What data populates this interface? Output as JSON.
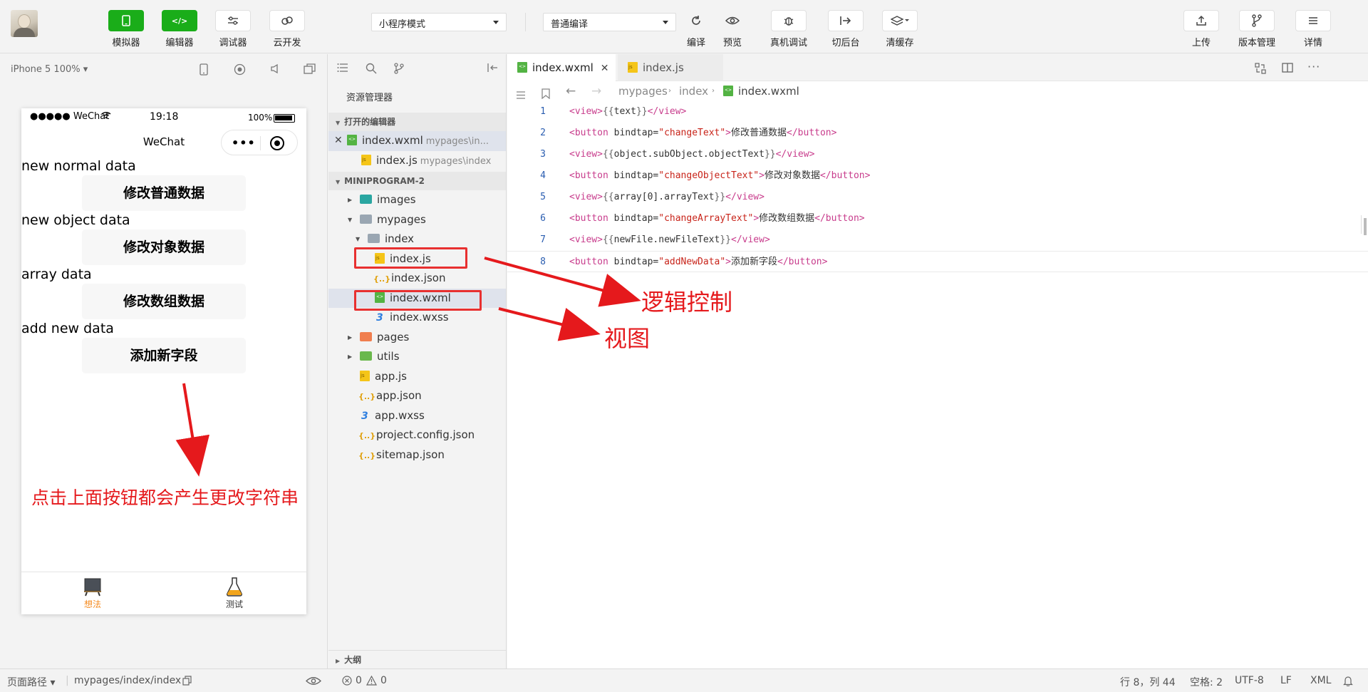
{
  "toolbar": {
    "simulator": "模拟器",
    "editor": "编辑器",
    "debugger": "调试器",
    "cloud": "云开发",
    "mode_select": "小程序模式",
    "compile_select": "普通编译",
    "compile": "编译",
    "preview": "预览",
    "real_debug": "真机调试",
    "background": "切后台",
    "clear_cache": "清缓存",
    "upload": "上传",
    "version": "版本管理",
    "details": "详情"
  },
  "simulator": {
    "device": "iPhone 5 100% ▾",
    "status": {
      "signal": "●●●●● WeChat",
      "time": "19:18",
      "battery": "100%"
    },
    "nav_title": "WeChat",
    "capsule_dots": "•••",
    "rows": [
      {
        "text": "new normal data",
        "button": "修改普通数据"
      },
      {
        "text": "new object data",
        "button": "修改对象数据"
      },
      {
        "text": "array data",
        "button": "修改数组数据"
      },
      {
        "text": "add new data",
        "button": "添加新字段"
      }
    ],
    "tabs": [
      {
        "label": "想法"
      },
      {
        "label": "测试"
      }
    ],
    "colors": {
      "tab_active": "#f58a1f",
      "tab_inactive": "#333333"
    }
  },
  "explorer": {
    "title": "资源管理器",
    "open_editors": "打开的编辑器",
    "open_files": [
      {
        "name": "index.wxml",
        "path": "mypages\\in..."
      },
      {
        "name": "index.js",
        "path": "mypages\\index"
      }
    ],
    "project": "MINIPROGRAM-2",
    "tree": {
      "images": "images",
      "mypages": "mypages",
      "index": "index",
      "index_js": "index.js",
      "index_json": "index.json",
      "index_wxml": "index.wxml",
      "index_wxss": "index.wxss",
      "pages": "pages",
      "utils": "utils",
      "app_js": "app.js",
      "app_json": "app.json",
      "app_wxss": "app.wxss",
      "project_config": "project.config.json",
      "sitemap": "sitemap.json"
    },
    "outline": "大纲"
  },
  "editor": {
    "tabs": [
      {
        "label": "index.wxml"
      },
      {
        "label": "index.js"
      }
    ],
    "breadcrumb": {
      "a": "mypages",
      "b": "index",
      "c": "index.wxml"
    },
    "lines": [
      {
        "n": "1",
        "parts": [
          [
            "t-tag",
            "<view>"
          ],
          [
            "t-mus",
            "{{"
          ],
          [
            "t-txt",
            "text"
          ],
          [
            "t-mus",
            "}}"
          ],
          [
            "t-tag",
            "</view>"
          ]
        ]
      },
      {
        "n": "2",
        "parts": [
          [
            "t-tag",
            "<button "
          ],
          [
            "t-attr",
            "bindtap="
          ],
          [
            "t-str",
            "\"changeText\""
          ],
          [
            "t-tag",
            ">"
          ],
          [
            "t-txt",
            "修改普通数据"
          ],
          [
            "t-tag",
            "</button>"
          ]
        ]
      },
      {
        "n": "3",
        "parts": [
          [
            "t-tag",
            "<view>"
          ],
          [
            "t-mus",
            "{{"
          ],
          [
            "t-txt",
            "object.subObject.objectText"
          ],
          [
            "t-mus",
            "}}"
          ],
          [
            "t-tag",
            "</view>"
          ]
        ]
      },
      {
        "n": "4",
        "parts": [
          [
            "t-tag",
            "<button "
          ],
          [
            "t-attr",
            "bindtap="
          ],
          [
            "t-str",
            "\"changeObjectText\""
          ],
          [
            "t-tag",
            ">"
          ],
          [
            "t-txt",
            "修改对象数据"
          ],
          [
            "t-tag",
            "</button>"
          ]
        ]
      },
      {
        "n": "5",
        "parts": [
          [
            "t-tag",
            "<view>"
          ],
          [
            "t-mus",
            "{{"
          ],
          [
            "t-txt",
            "array[0].arrayText"
          ],
          [
            "t-mus",
            "}}"
          ],
          [
            "t-tag",
            "</view>"
          ]
        ]
      },
      {
        "n": "6",
        "parts": [
          [
            "t-tag",
            "<button "
          ],
          [
            "t-attr",
            "bindtap="
          ],
          [
            "t-str",
            "\"changeArrayText\""
          ],
          [
            "t-tag",
            ">"
          ],
          [
            "t-txt",
            "修改数组数据"
          ],
          [
            "t-tag",
            "</button>"
          ]
        ]
      },
      {
        "n": "7",
        "parts": [
          [
            "t-tag",
            "<view>"
          ],
          [
            "t-mus",
            "{{"
          ],
          [
            "t-txt",
            "newFile.newFileText"
          ],
          [
            "t-mus",
            "}}"
          ],
          [
            "t-tag",
            "</view>"
          ]
        ]
      },
      {
        "n": "8",
        "parts": [
          [
            "t-tag",
            "<button "
          ],
          [
            "t-attr",
            "bindtap="
          ],
          [
            "t-str",
            "\"addNewData\""
          ],
          [
            "t-tag",
            ">"
          ],
          [
            "t-txt",
            "添加新字段"
          ],
          [
            "t-tag",
            "</button>"
          ]
        ]
      }
    ]
  },
  "statusbar": {
    "page_path_label": "页面路径 ▾",
    "page_path": "mypages/index/index",
    "errors": "0",
    "warnings": "0",
    "position": "行 8，列 44",
    "spaces": "空格: 2",
    "encoding": "UTF-8",
    "eol": "LF",
    "language": "XML"
  },
  "annotations": {
    "logic": "逻辑控制",
    "view": "视图",
    "hint": "点击上面按钮都会产生更改字符串",
    "color": "#e5191c"
  }
}
